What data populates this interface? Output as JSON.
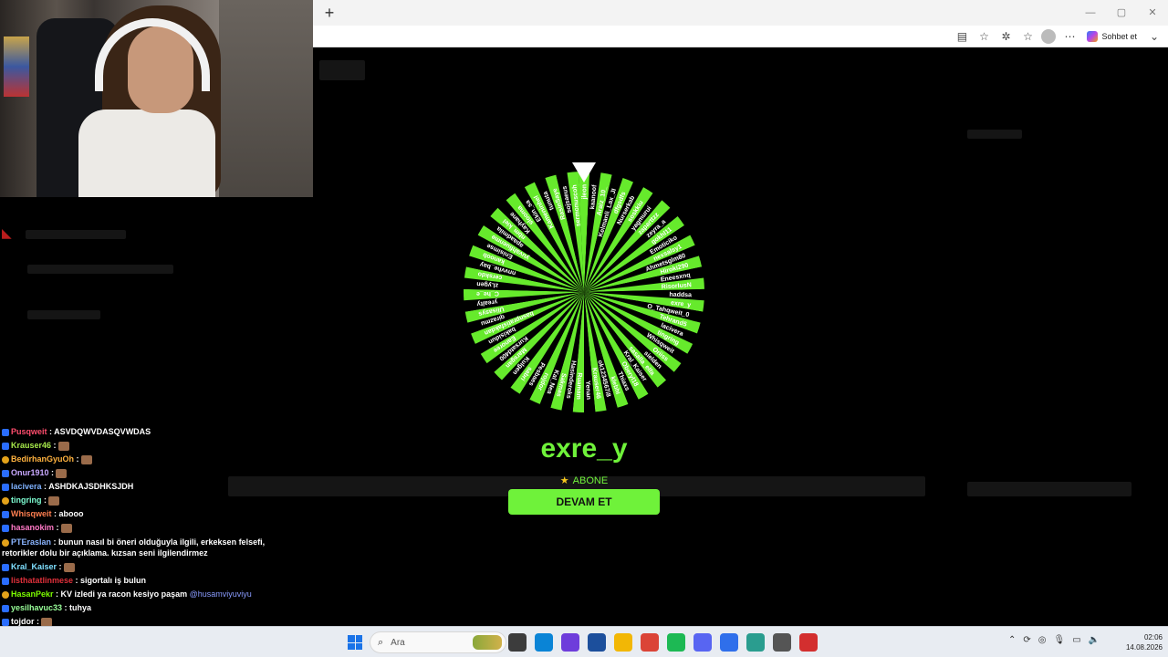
{
  "browser": {
    "new_tab_glyph": "+",
    "window_controls": [
      "—",
      "▢",
      "✕"
    ],
    "copilot_label": "Sohbet et"
  },
  "wheel": {
    "segment_colors": [
      "#66ea2c",
      "#000000"
    ],
    "entries": [
      "jleon",
      "kaanoof",
      "Araiz_10_",
      "Kelmanli_Lax_JI",
      "dfgsdfs",
      "Nurserkab",
      "soskkiu",
      "yagmurui",
      "zaparttzz",
      "zeyra_a",
      "gokhl11",
      "Emoticiko",
      "nexsalsy1",
      "Ahmetsglm80",
      "Hiroki290",
      "Eneesxnq",
      "RisorIusN",
      "haddsa",
      "exre_y",
      "O_Tahqweit_0",
      "Tehrand5",
      "lacivera",
      "tingring",
      "Whisqweit",
      "Oriiss",
      "sielden",
      "sasalla_elfa",
      "Kral_Kaiser",
      "Oberyl18",
      "Thiaxs",
      "klebhi",
      "ok1234567i8",
      "Krauser46",
      "Yenan",
      "Ruamam",
      "Hasinderoks",
      "Sakmas",
      "Kal_Nea",
      "rojdor",
      "Pesbaes",
      "sabri",
      "Kulgen",
      "Marsgan",
      "Kursatd400",
      "Eanoree",
      "bakisidun",
      "basnpratisfakdan",
      "qirazmu",
      "Ulisasys",
      "yrealty",
      "C_he_e",
      "zLygen",
      "cerskdo",
      "nnvvhe_bay",
      "kanoob",
      "Enisimse",
      "yuvahfiuenme",
      "apaadmila",
      "nbm_kiel",
      "Kayhane",
      "slooma",
      "Ekin_sa",
      "Kameninhel",
      "tunuta",
      "RasinSaye",
      "sojsaeus",
      "sermonuscoh"
    ]
  },
  "result": {
    "winner": "exre_y",
    "badge_label": "ABONE",
    "continue_button": "DEVAM ET"
  },
  "chat": [
    {
      "user": "Pusqweit",
      "color": "#ff4d6d",
      "text": ": ASVDQWVDASQVWDAS"
    },
    {
      "user": "Krauser46",
      "color": "#a6e84a",
      "text": ":"
    },
    {
      "user": "BedirhanGyuOh",
      "color": "#ffb23f",
      "text": ":"
    },
    {
      "user": "Onur1910",
      "color": "#c9a9ff",
      "text": ":"
    },
    {
      "user": "lacivera",
      "color": "#7fb2ff",
      "text": ": ASHDKAJSDHKSJDH"
    },
    {
      "user": "tingring",
      "color": "#7fffd4",
      "text": ":"
    },
    {
      "user": "Whisqweit",
      "color": "#ff7f50",
      "text": ": abooo"
    },
    {
      "user": "hasanokim",
      "color": "#ff79c6",
      "text": ":"
    },
    {
      "user": "PTEraslan",
      "color": "#8ab4ff",
      "text": ": bunun nasıl bi öneri olduğuyla ilgili, erkeksen felsefi, retorikler dolu bir açıklama. kızsan seni ilgilendirmez"
    },
    {
      "user": "Kral_Kaiser",
      "color": "#7fe0ff",
      "text": ":"
    },
    {
      "user": "listhatatlinmese",
      "color": "#e0303a",
      "text": ": sigortalı iş bulun"
    },
    {
      "user": "HasanPekr",
      "color": "#7cfc00",
      "text": ": KV izledi ya racon kesiyo paşam",
      "mention": "@husamviyuviyu"
    },
    {
      "user": "yesilhavuc33",
      "color": "#9aff9a",
      "text": ": tuhya"
    },
    {
      "user": "tojdor",
      "color": "#ffffff",
      "text": ":"
    }
  ],
  "taskbar": {
    "search_placeholder": "Ara",
    "search_icon": "search-icon",
    "time": "02:06",
    "date": "14.08.2026",
    "app_colors": [
      "#3c3c3c",
      "#0a84d6",
      "#6e3ddb",
      "#1c4f9c",
      "#f2b705",
      "#db4437",
      "#1db954",
      "#5865f2",
      "#2f6feb",
      "#2a9d8f",
      "#555555",
      "#d32f2f"
    ]
  }
}
